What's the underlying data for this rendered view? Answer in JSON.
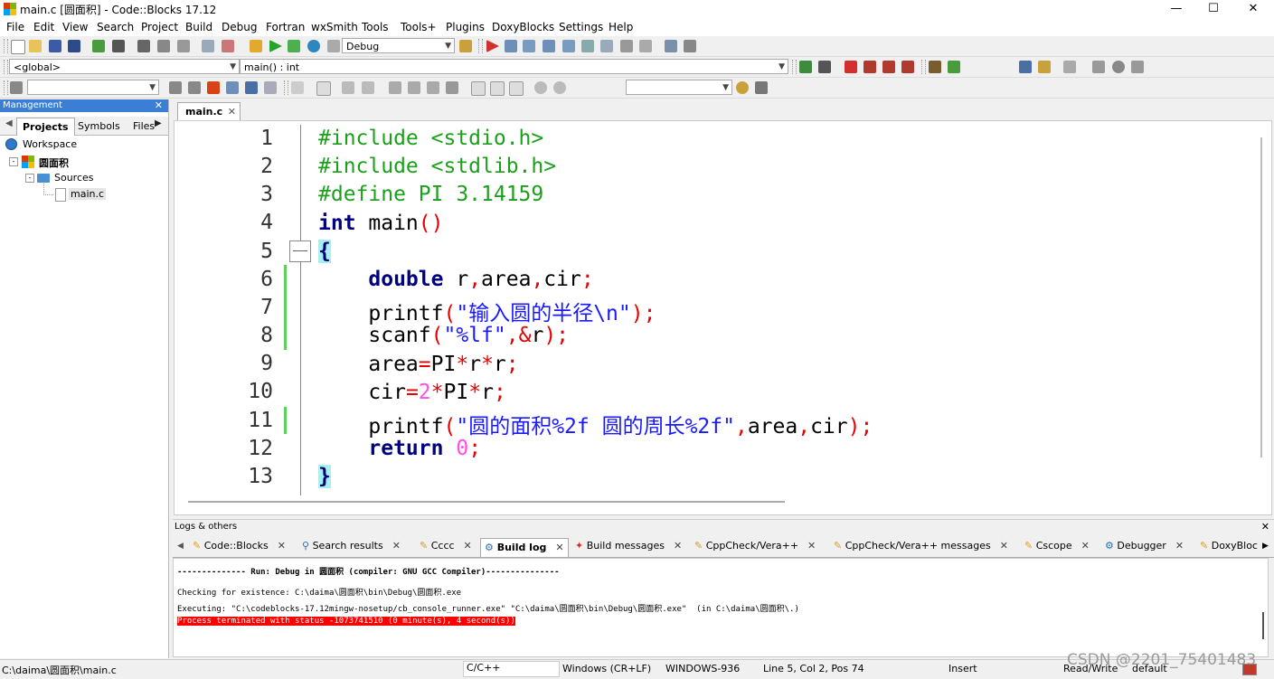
{
  "window": {
    "title": "main.c [圆面积] - Code::Blocks 17.12",
    "minimize": "—",
    "maximize": "☐",
    "close": "✕"
  },
  "menu": [
    "File",
    "Edit",
    "View",
    "Search",
    "Project",
    "Build",
    "Debug",
    "Fortran",
    "wxSmith",
    "Tools",
    "Tools+",
    "Plugins",
    "DoxyBlocks",
    "Settings",
    "Help"
  ],
  "toolbar": {
    "build_target": "Debug",
    "scope": "<global>",
    "function": "main() : int",
    "doc_comment_1": "/**",
    "doc_comment_2": "*<"
  },
  "management": {
    "title": "Management",
    "tabs": [
      "Projects",
      "Symbols",
      "Files"
    ],
    "tree": {
      "workspace": "Workspace",
      "project": "圆面积",
      "folder": "Sources",
      "file": "main.c"
    }
  },
  "editor": {
    "tab_label": "main.c",
    "line_numbers": [
      "1",
      "2",
      "3",
      "4",
      "5",
      "6",
      "7",
      "8",
      "9",
      "10",
      "11",
      "12",
      "13"
    ]
  },
  "logs": {
    "title": "Logs & others",
    "tabs": [
      "Code::Blocks",
      "Search results",
      "Cccc",
      "Build log",
      "Build messages",
      "CppCheck/Vera++",
      "CppCheck/Vera++ messages",
      "Cscope",
      "Debugger",
      "DoxyBloc"
    ],
    "active_tab": "Build log",
    "lines": [
      "-------------- Run: Debug in 圆面积 (compiler: GNU GCC Compiler)---------------",
      "Checking for existence: C:\\daima\\圆面积\\bin\\Debug\\圆面积.exe",
      "Executing: \"C:\\codeblocks-17.12mingw-nosetup/cb_console_runner.exe\" \"C:\\daima\\圆面积\\bin\\Debug\\圆面积.exe\"  (in C:\\daima\\圆面积\\.)",
      "Process terminated with status -1073741510 (0 minute(s), 4 second(s))"
    ]
  },
  "status": {
    "path": "C:\\daima\\圆面积\\main.c",
    "language": "C/C++",
    "eol": "Windows (CR+LF)",
    "encoding": "WINDOWS-936",
    "position": "Line 5, Col 2, Pos 74",
    "mode": "Insert",
    "access": "Read/Write",
    "profile": "default",
    "watermark": "CSDN @2201_75401483"
  },
  "colors": {
    "keyword": "#00007f",
    "preprocessor": "#1ca01c",
    "operator": "#e60000",
    "string": "#1a1aff",
    "number": "#ff4df0",
    "error_bg": "#ff0000",
    "panel_header": "#3a7fd5"
  }
}
